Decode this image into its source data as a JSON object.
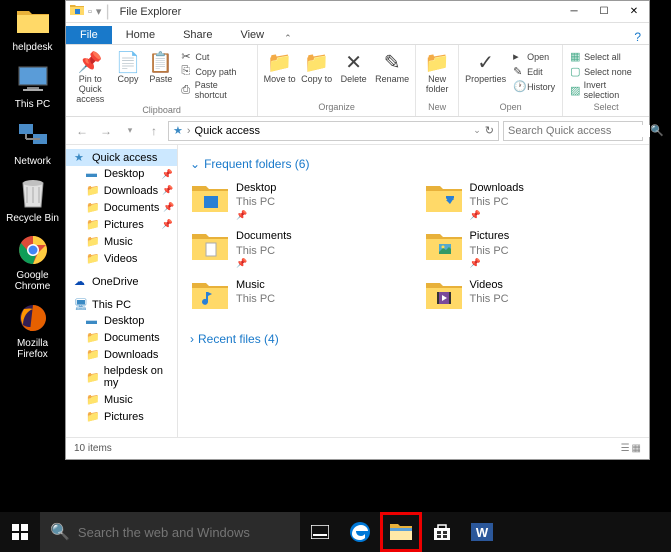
{
  "desktop": {
    "items": [
      {
        "name": "helpdesk"
      },
      {
        "name": "This PC"
      },
      {
        "name": "Network"
      },
      {
        "name": "Recycle Bin"
      },
      {
        "name": "Google Chrome"
      },
      {
        "name": "Mozilla Firefox"
      }
    ]
  },
  "window": {
    "title": "File Explorer",
    "tabs": {
      "file": "File",
      "home": "Home",
      "share": "Share",
      "view": "View"
    },
    "ribbon": {
      "pin": "Pin to Quick access",
      "copy": "Copy",
      "paste": "Paste",
      "cut": "Cut",
      "copypath": "Copy path",
      "pasteshortcut": "Paste shortcut",
      "clipboard": "Clipboard",
      "moveto": "Move to",
      "copyto": "Copy to",
      "delete": "Delete",
      "rename": "Rename",
      "organize": "Organize",
      "newfolder": "New folder",
      "new": "New",
      "properties": "Properties",
      "open": "Open",
      "edit": "Edit",
      "history": "History",
      "opengroup": "Open",
      "selectall": "Select all",
      "selectnone": "Select none",
      "invertselection": "Invert selection",
      "select": "Select"
    },
    "address": {
      "location": "Quick access",
      "search_placeholder": "Search Quick access"
    },
    "nav": {
      "quickaccess": "Quick access",
      "items": [
        {
          "label": "Desktop",
          "pinned": true
        },
        {
          "label": "Downloads",
          "pinned": true
        },
        {
          "label": "Documents",
          "pinned": true
        },
        {
          "label": "Pictures",
          "pinned": true
        },
        {
          "label": "Music",
          "pinned": false
        },
        {
          "label": "Videos",
          "pinned": false
        }
      ],
      "onedrive": "OneDrive",
      "thispc": "This PC",
      "pcitems": [
        {
          "label": "Desktop"
        },
        {
          "label": "Documents"
        },
        {
          "label": "Downloads"
        },
        {
          "label": "helpdesk on my"
        },
        {
          "label": "Music"
        },
        {
          "label": "Pictures"
        }
      ]
    },
    "content": {
      "frequent": "Frequent folders (6)",
      "folders": [
        {
          "name": "Desktop",
          "loc": "This PC"
        },
        {
          "name": "Downloads",
          "loc": "This PC"
        },
        {
          "name": "Documents",
          "loc": "This PC"
        },
        {
          "name": "Pictures",
          "loc": "This PC"
        },
        {
          "name": "Music",
          "loc": "This PC"
        },
        {
          "name": "Videos",
          "loc": "This PC"
        }
      ],
      "recent": "Recent files (4)"
    },
    "status": "10 items"
  },
  "taskbar": {
    "search_placeholder": "Search the web and Windows"
  }
}
